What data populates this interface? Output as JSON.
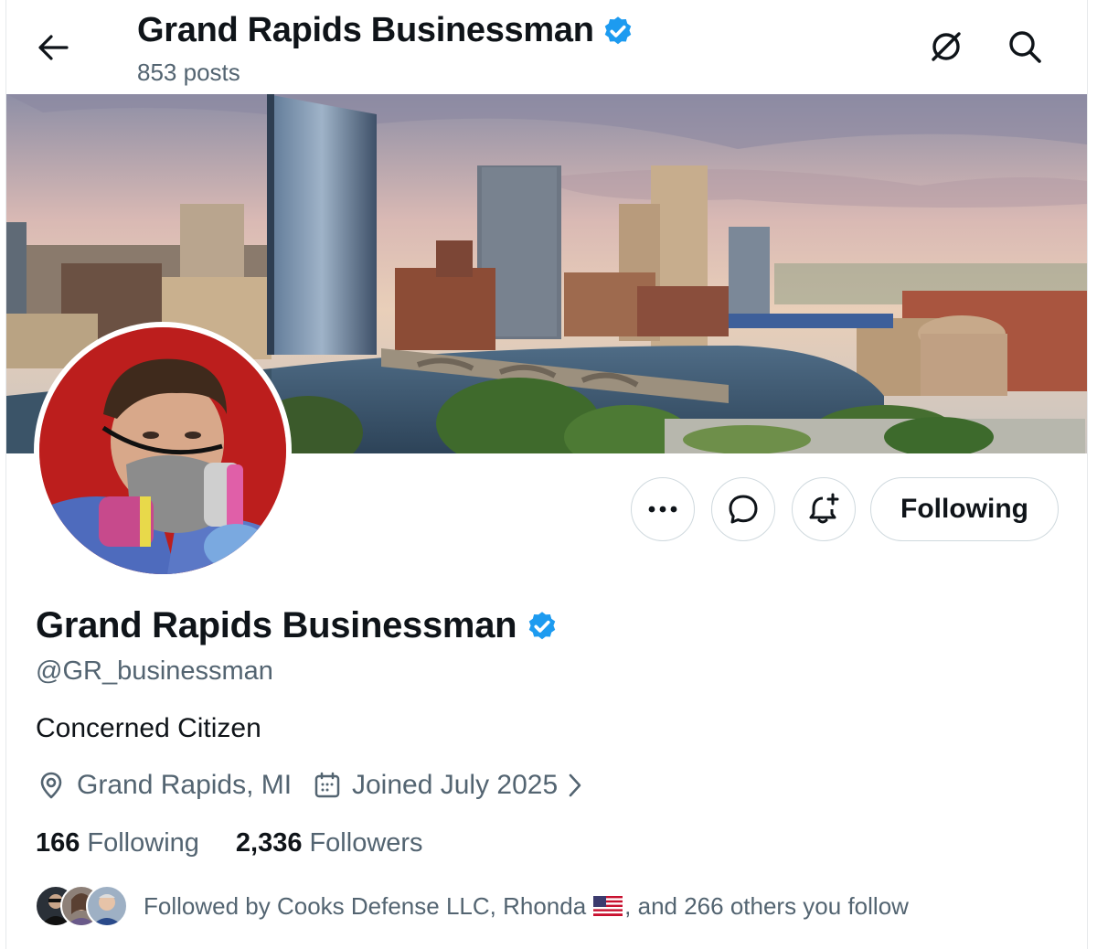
{
  "header": {
    "title": "Grand Rapids Businessman",
    "posts": "853 posts",
    "icons": [
      "back-arrow-icon",
      "grok-icon",
      "search-icon"
    ]
  },
  "profile": {
    "name": "Grand Rapids Businessman",
    "handle": "@GR_businessman",
    "bio": "Concerned Citizen",
    "location": "Grand Rapids, MI",
    "joined": "Joined July 2025",
    "following_count": "166",
    "following_label": "Following",
    "followers_count": "2,336",
    "followers_label": "Followers"
  },
  "actions": {
    "more_icon": "more-icon",
    "message_icon": "message-icon",
    "notify_icon": "notification-bell-icon",
    "following_button": "Following"
  },
  "followed_by": {
    "prefix": "Followed by Cooks Defense LLC, Rhonda",
    "suffix": ", and 266 others you follow"
  },
  "colors": {
    "verified": "#1d9bf0",
    "secondary_text": "#536471",
    "primary_text": "#0f1419",
    "border": "#cfd9de"
  }
}
